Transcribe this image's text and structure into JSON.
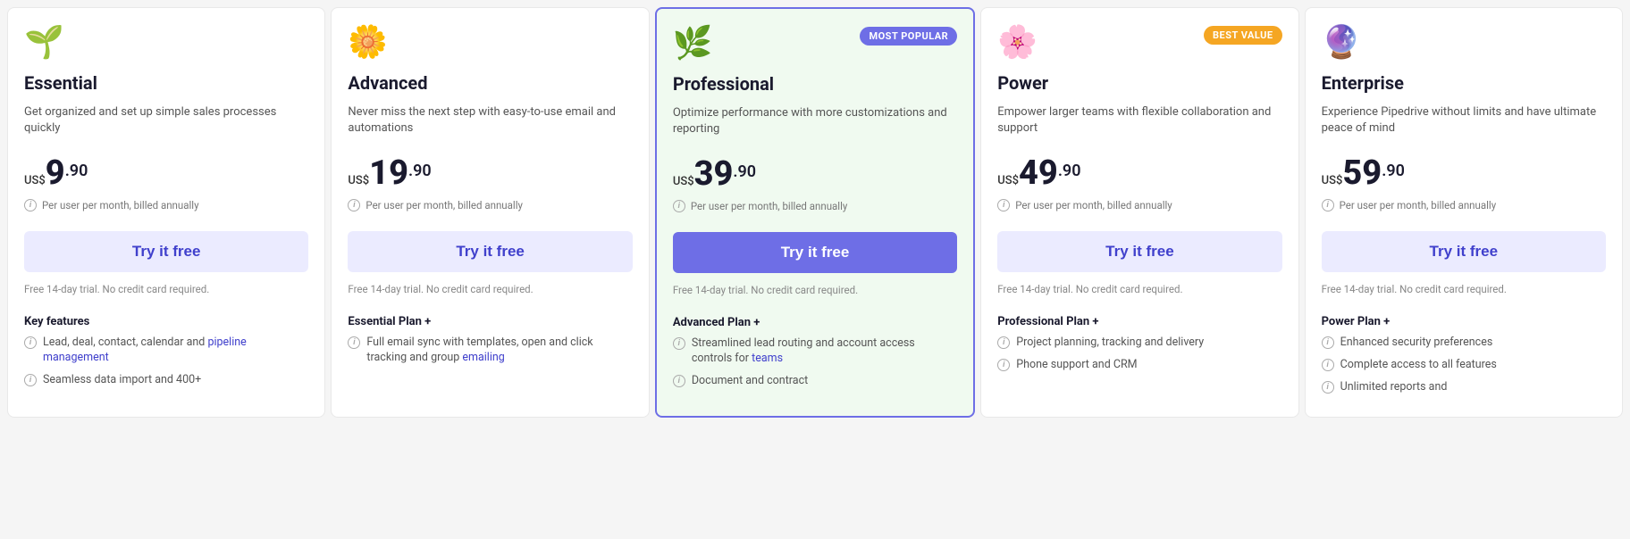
{
  "plans": [
    {
      "id": "essential",
      "icon": "🌱",
      "name": "Essential",
      "description": "Get organized and set up simple sales processes quickly",
      "currency": "US$",
      "price_main": "9",
      "price_decimal": ".90",
      "billing": "Per user per month, billed annually",
      "cta": "Try it free",
      "cta_style": "light",
      "trial_note": "Free 14-day trial. No credit card required.",
      "badge": null,
      "features_title": "Key features",
      "features": [
        "Lead, deal, contact, calendar and pipeline management",
        "Seamless data import and 400+"
      ]
    },
    {
      "id": "advanced",
      "icon": "🌼",
      "name": "Advanced",
      "description": "Never miss the next step with easy-to-use email and automations",
      "currency": "US$",
      "price_main": "19",
      "price_decimal": ".90",
      "billing": "Per user per month, billed annually",
      "cta": "Try it free",
      "cta_style": "light",
      "trial_note": "Free 14-day trial. No credit card required.",
      "badge": null,
      "features_title": "Essential Plan +",
      "features": [
        "Full email sync with templates, open and click tracking and group emailing"
      ]
    },
    {
      "id": "professional",
      "icon": "🌿",
      "name": "Professional",
      "description": "Optimize performance with more customizations and reporting",
      "currency": "US$",
      "price_main": "39",
      "price_decimal": ".90",
      "billing": "Per user per month, billed annually",
      "cta": "Try it free",
      "cta_style": "dark",
      "trial_note": "Free 14-day trial. No credit card required.",
      "badge": "MOST POPULAR",
      "badge_style": "popular",
      "features_title": "Advanced Plan +",
      "features": [
        "Streamlined lead routing and account access controls for teams",
        "Document and contract"
      ]
    },
    {
      "id": "power",
      "icon": "🌸",
      "name": "Power",
      "description": "Empower larger teams with flexible collaboration and support",
      "currency": "US$",
      "price_main": "49",
      "price_decimal": ".90",
      "billing": "Per user per month, billed annually",
      "cta": "Try it free",
      "cta_style": "light",
      "trial_note": "Free 14-day trial. No credit card required.",
      "badge": "BEST VALUE",
      "badge_style": "value",
      "features_title": "Professional Plan +",
      "features": [
        "Project planning, tracking and delivery",
        "Phone support and CRM"
      ]
    },
    {
      "id": "enterprise",
      "icon": "🔮",
      "name": "Enterprise",
      "description": "Experience Pipedrive without limits and have ultimate peace of mind",
      "currency": "US$",
      "price_main": "59",
      "price_decimal": ".90",
      "billing": "Per user per month, billed annually",
      "cta": "Try it free",
      "cta_style": "light",
      "trial_note": "Free 14-day trial. No credit card required.",
      "badge": null,
      "features_title": "Power Plan +",
      "features": [
        "Enhanced security preferences",
        "Complete access to all features",
        "Unlimited reports and"
      ]
    }
  ]
}
